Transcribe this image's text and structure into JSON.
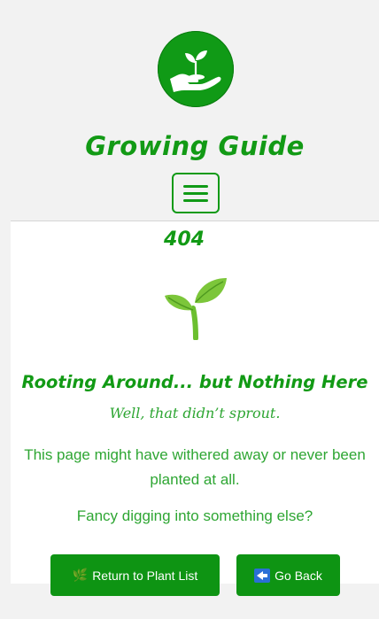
{
  "header": {
    "logo_icon": "hand-holding-seedling-icon",
    "site_title": "Growing Guide",
    "menu_icon": "hamburger-menu-icon"
  },
  "error": {
    "code": "404",
    "illustration_icon": "seedling-icon",
    "headline": "Rooting Around... but Nothing Here",
    "tagline": "Well, that didn’t sprout.",
    "description": "This page might have withered away or never been planted at all.",
    "prompt": "Fancy digging into something else?"
  },
  "actions": {
    "return_icon": "🌿",
    "return_label": "Return to Plant List",
    "back_icon": "back-arrow-icon",
    "back_label": "Go Back"
  },
  "colors": {
    "brand_green": "#109a16",
    "text_green": "#2ea633",
    "button_green": "#0e9413"
  }
}
